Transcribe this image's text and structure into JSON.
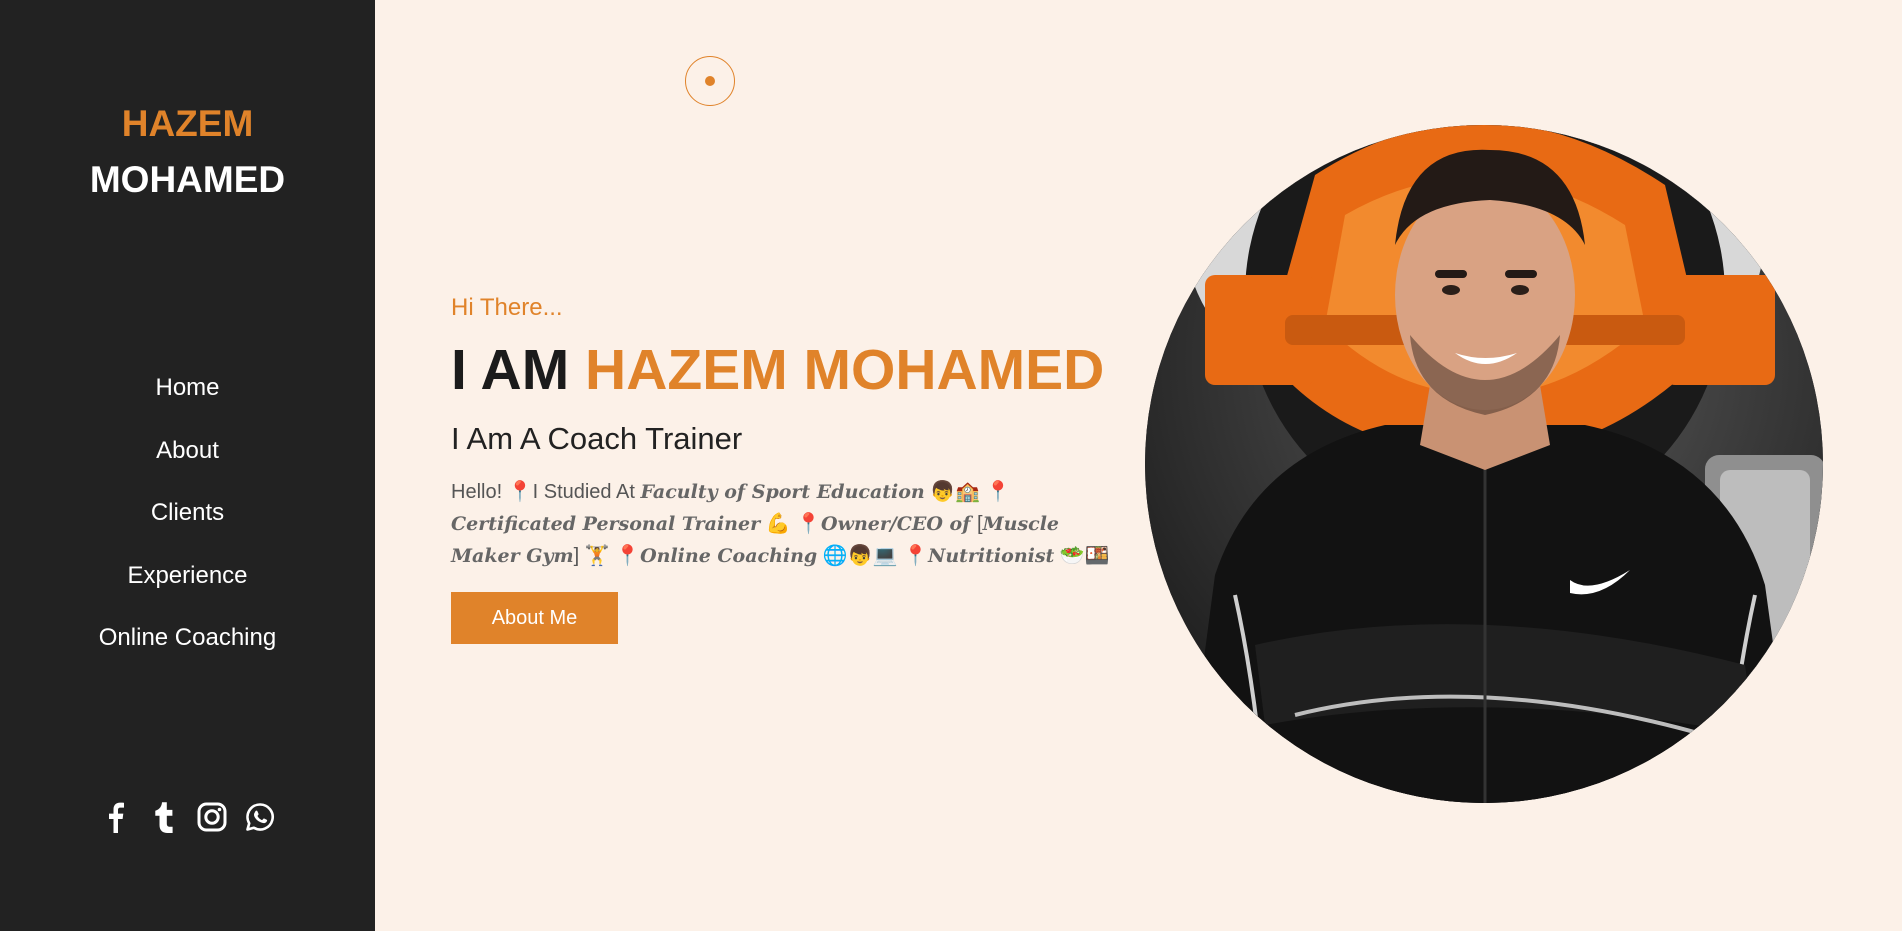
{
  "brand": {
    "first": "HAZEM",
    "last": "MOHAMED"
  },
  "nav": [
    {
      "label": "Home"
    },
    {
      "label": "About"
    },
    {
      "label": "Clients"
    },
    {
      "label": "Experience"
    },
    {
      "label": "Online Coaching"
    }
  ],
  "social": [
    "facebook-icon",
    "tumblr-icon",
    "instagram-icon",
    "whatsapp-icon"
  ],
  "hero": {
    "greeting": "Hi There...",
    "headline_prefix": "I AM ",
    "headline_name": "HAZEM MOHAMED",
    "subtitle": "I Am A Coach Trainer",
    "bio": {
      "hello": "Hello! ",
      "studied": "I Studied At ",
      "faculty": "Faculty of Sport Education",
      "trainer": "Certificated Personal Trainer",
      "owner_prefix": "Owner/CEO of ",
      "gym_open": "[",
      "gym": "Muscle Maker Gym",
      "gym_close": "]",
      "online": "Online Coaching",
      "nutrition": "Nutritionist"
    },
    "cta": "About Me"
  },
  "colors": {
    "accent": "#e0832a",
    "sidebar": "#222222",
    "background": "#fcf1e8"
  }
}
